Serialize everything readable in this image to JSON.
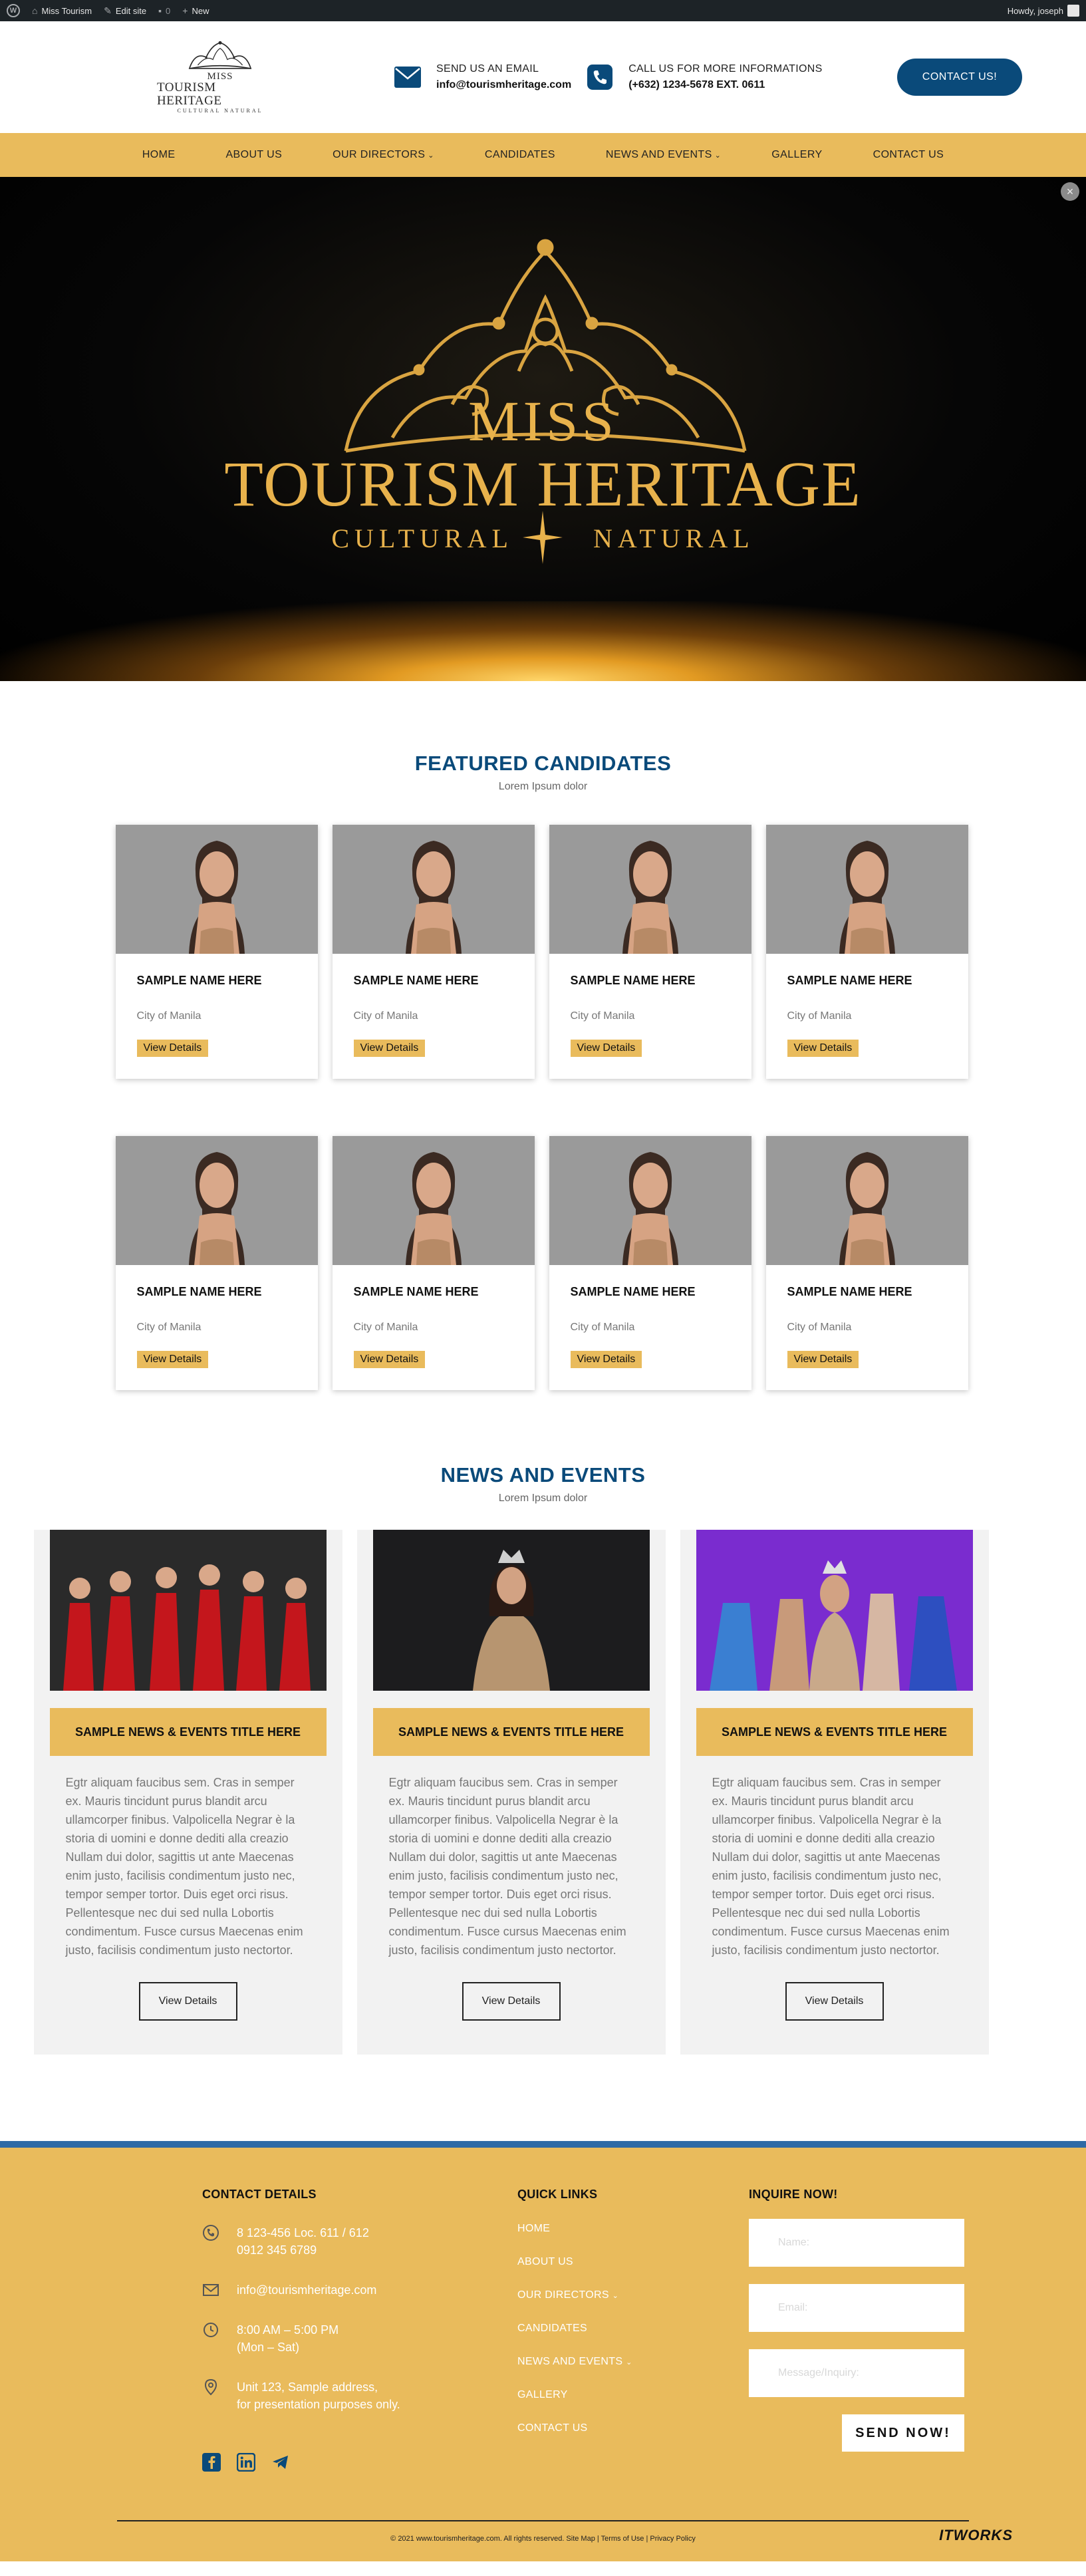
{
  "adminbar": {
    "site_name": "Miss Tourism",
    "edit_site": "Edit site",
    "comments_count": "0",
    "new_label": "New",
    "howdy": "Howdy, joseph"
  },
  "header": {
    "logo_line1": "MISS",
    "logo_line2": "TOURISM HERITAGE",
    "logo_line3": "CULTURAL   NATURAL",
    "email_label": "SEND US AN EMAIL",
    "email_value": "info@tourismheritage.com",
    "phone_label": "CALL US FOR MORE INFORMATIONS",
    "phone_value": "(+632) 1234-5678 EXT. 0611",
    "contact_button": "CONTACT US!"
  },
  "nav": {
    "items": [
      {
        "label": "HOME",
        "dropdown": false
      },
      {
        "label": "ABOUT US",
        "dropdown": false
      },
      {
        "label": "OUR DIRECTORS",
        "dropdown": true
      },
      {
        "label": "CANDIDATES",
        "dropdown": false
      },
      {
        "label": "NEWS AND EVENTS",
        "dropdown": true
      },
      {
        "label": "GALLERY",
        "dropdown": false
      },
      {
        "label": "CONTACT US",
        "dropdown": false
      }
    ]
  },
  "hero": {
    "miss": "MISS",
    "title": "TOURISM HERITAGE",
    "sub_left": "CULTURAL",
    "sub_right": "NATURAL",
    "close_icon": "close-icon"
  },
  "featured": {
    "title": "FEATURED CANDIDATES",
    "subtitle": "Lorem Ipsum dolor",
    "candidates": [
      {
        "name": "SAMPLE NAME HERE",
        "city": "City of Manila",
        "button": "View Details"
      },
      {
        "name": "SAMPLE NAME HERE",
        "city": "City of Manila",
        "button": "View Details"
      },
      {
        "name": "SAMPLE NAME HERE",
        "city": "City of Manila",
        "button": "View Details"
      },
      {
        "name": "SAMPLE NAME HERE",
        "city": "City of Manila",
        "button": "View Details"
      },
      {
        "name": "SAMPLE NAME HERE",
        "city": "City of Manila",
        "button": "View Details"
      },
      {
        "name": "SAMPLE NAME HERE",
        "city": "City of Manila",
        "button": "View Details"
      },
      {
        "name": "SAMPLE NAME HERE",
        "city": "City of Manila",
        "button": "View Details"
      },
      {
        "name": "SAMPLE NAME HERE",
        "city": "City of Manila",
        "button": "View Details"
      }
    ]
  },
  "news": {
    "title": "NEWS AND EVENTS",
    "subtitle": "Lorem Ipsum dolor",
    "items": [
      {
        "title": "SAMPLE NEWS & EVENTS TITLE HERE",
        "text": "Egtr aliquam faucibus sem. Cras in semper ex. Mauris tincidunt purus blandit arcu ullamcorper finibus. Valpolicella Negrar è la storia di uomini e donne dediti alla creazio Nullam dui dolor, sagittis ut ante Maecenas enim justo, facilisis condimentum justo nec, tempor semper tortor. Duis eget orci risus. Pellentesque nec dui sed nulla Lobortis condimentum. Fusce cursus Maecenas enim justo, facilisis condimentum justo nectortor.",
        "button": "View Details"
      },
      {
        "title": "SAMPLE NEWS & EVENTS TITLE HERE",
        "text": "Egtr aliquam faucibus sem. Cras in semper ex. Mauris tincidunt purus blandit arcu ullamcorper finibus. Valpolicella Negrar è la storia di uomini e donne dediti alla creazio Nullam dui dolor, sagittis ut ante Maecenas enim justo, facilisis condimentum justo nec, tempor semper tortor. Duis eget orci risus. Pellentesque nec dui sed nulla Lobortis condimentum. Fusce cursus Maecenas enim justo, facilisis condimentum justo nectortor.",
        "button": "View Details"
      },
      {
        "title": "SAMPLE NEWS & EVENTS TITLE HERE",
        "text": "Egtr aliquam faucibus sem. Cras in semper ex. Mauris tincidunt purus blandit arcu ullamcorper finibus. Valpolicella Negrar è la storia di uomini e donne dediti alla creazio Nullam dui dolor, sagittis ut ante Maecenas enim justo, facilisis condimentum justo nec, tempor semper tortor. Duis eget orci risus. Pellentesque nec dui sed nulla Lobortis condimentum. Fusce cursus Maecenas enim justo, facilisis condimentum justo nectortor.",
        "button": "View Details"
      }
    ]
  },
  "footer": {
    "contact_title": "CONTACT DETAILS",
    "phone_lines": "8 123-456 Loc. 611 / 612\n0912 345 6789",
    "email": "info@tourismheritage.com",
    "hours": "8:00 AM – 5:00 PM\n(Mon – Sat)",
    "address": "Unit 123, Sample address,\nfor presentation purposes only.",
    "links_title": "QUICK LINKS",
    "links": [
      "HOME",
      "ABOUT US",
      "OUR DIRECTORS",
      "CANDIDATES",
      "NEWS AND EVENTS",
      "GALLERY",
      "CONTACT US"
    ],
    "inquire_title": "INQUIRE NOW!",
    "name_placeholder": "Name:",
    "email_placeholder": "Email:",
    "message_placeholder": "Message/Inquiry:",
    "send_button": "SEND NOW!",
    "copyright": "© 2021 www.tourismheritage.com. All rights reserved.  Site Map | Terms of Use | Privacy Policy",
    "credit": "ITWORKS"
  },
  "colors": {
    "primary_blue": "#0a4a7a",
    "gold": "#e9bb5c",
    "hero_gold": "#e8b24c",
    "footer_bar": "#2f6aa5"
  }
}
